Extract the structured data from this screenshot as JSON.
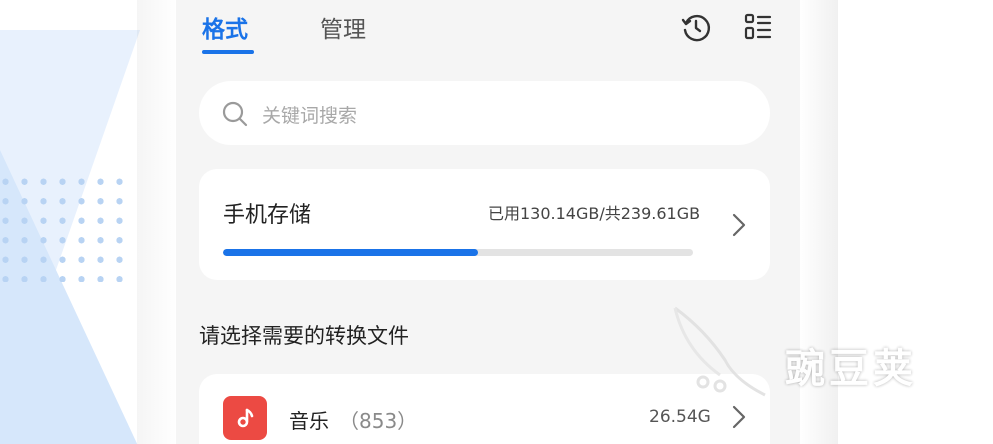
{
  "tabs": [
    {
      "label": "格式",
      "active": true
    },
    {
      "label": "管理",
      "active": false
    }
  ],
  "header_icons": [
    "history-icon",
    "list-menu-icon"
  ],
  "search": {
    "placeholder": "关键词搜索",
    "icon": "search-icon"
  },
  "storage": {
    "title": "手机存储",
    "usage": "已用130.14GB/共239.61GB",
    "used_fraction": 0.5431
  },
  "section_title": "请选择需要的转换文件",
  "files": [
    {
      "name": "音乐",
      "count": "（853）",
      "size": "26.54G",
      "icon": "music-note-icon",
      "icon_color": "#ec4a43"
    }
  ],
  "watermark": {
    "text": "豌豆荚"
  },
  "colors": {
    "accent": "#1a73e8",
    "background": "#f5f5f5"
  }
}
